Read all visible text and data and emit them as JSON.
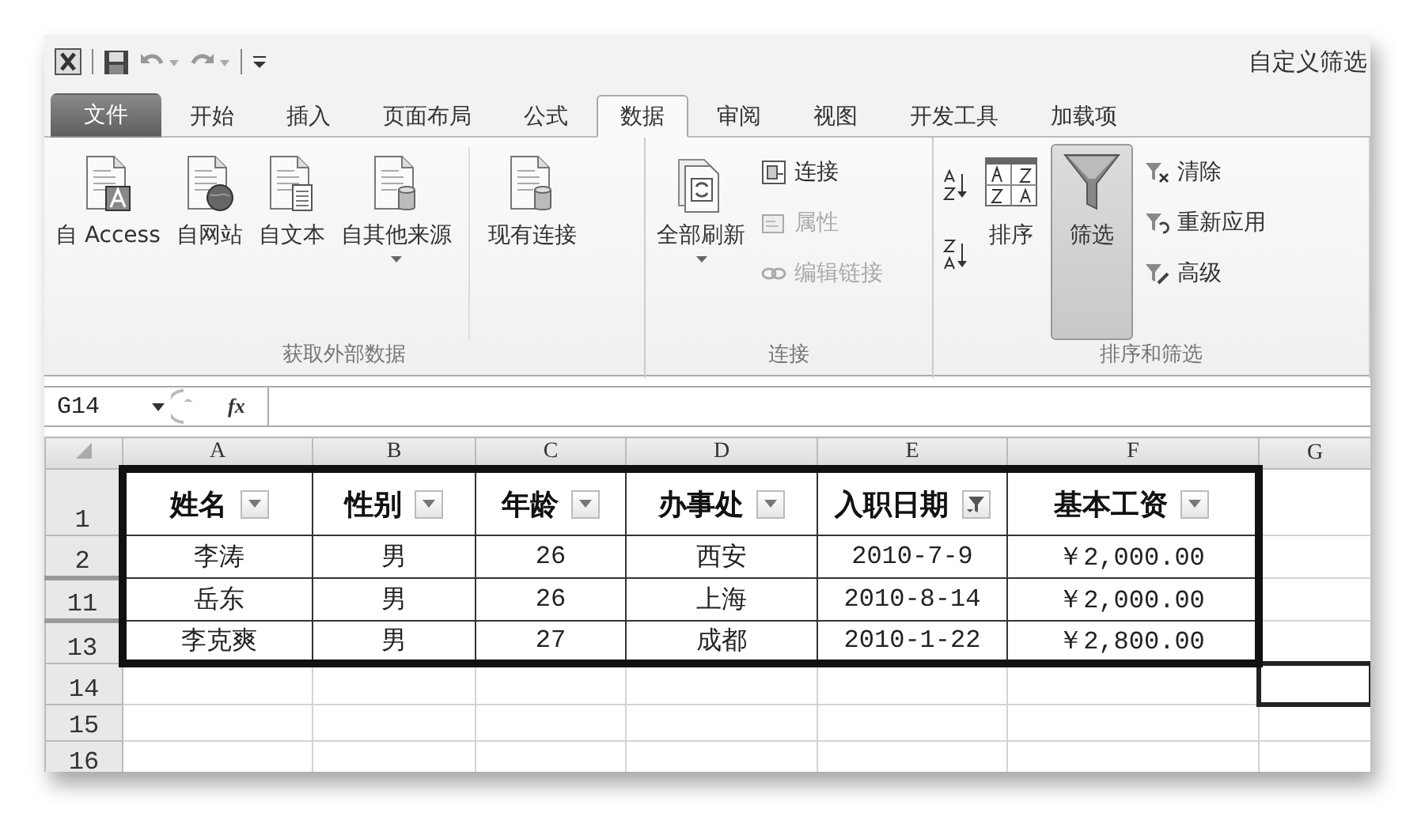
{
  "window": {
    "title": "自定义筛选"
  },
  "tabs": [
    {
      "label": "文件",
      "kind": "file",
      "selected": false
    },
    {
      "label": "开始",
      "kind": "tab",
      "selected": false
    },
    {
      "label": "插入",
      "kind": "tab",
      "selected": false
    },
    {
      "label": "页面布局",
      "kind": "tab",
      "selected": false
    },
    {
      "label": "公式",
      "kind": "tab",
      "selected": false
    },
    {
      "label": "数据",
      "kind": "tab",
      "selected": true
    },
    {
      "label": "审阅",
      "kind": "tab",
      "selected": false
    },
    {
      "label": "视图",
      "kind": "tab",
      "selected": false
    },
    {
      "label": "开发工具",
      "kind": "tab",
      "selected": false
    },
    {
      "label": "加载项",
      "kind": "tab",
      "selected": false
    }
  ],
  "ribbon": {
    "groups": [
      {
        "label": "获取外部数据",
        "items": [
          {
            "kind": "large",
            "label": "自 Access",
            "dropdown": false
          },
          {
            "kind": "large",
            "label": "自网站",
            "dropdown": false
          },
          {
            "kind": "large",
            "label": "自文本",
            "dropdown": false
          },
          {
            "kind": "large",
            "label": "自其他来源",
            "dropdown": true
          },
          {
            "kind": "separator"
          },
          {
            "kind": "large",
            "label": "现有连接",
            "dropdown": false
          }
        ]
      },
      {
        "label": "连接",
        "items": [
          {
            "kind": "large",
            "label": "全部刷新",
            "dropdown": true
          },
          {
            "kind": "small",
            "label": "连接",
            "disabled": false
          },
          {
            "kind": "small",
            "label": "属性",
            "disabled": true
          },
          {
            "kind": "small",
            "label": "编辑链接",
            "disabled": true
          }
        ]
      },
      {
        "label": "排序和筛选",
        "items": [
          {
            "kind": "sort-ascending"
          },
          {
            "kind": "sort-descending"
          },
          {
            "kind": "large",
            "label": "排序",
            "dropdown": false
          },
          {
            "kind": "large",
            "label": "筛选",
            "dropdown": false,
            "selected": true
          },
          {
            "kind": "small",
            "label": "清除",
            "disabled": false
          },
          {
            "kind": "small",
            "label": "重新应用",
            "disabled": false
          },
          {
            "kind": "small",
            "label": "高级",
            "disabled": false
          }
        ]
      }
    ]
  },
  "formula_bar": {
    "name_box": "G14",
    "function_label": "fx"
  },
  "table": {
    "columns": [
      "A",
      "B",
      "C",
      "D",
      "E",
      "F",
      "G"
    ],
    "header_row": "1",
    "header": [
      {
        "text": "姓名",
        "filtered": false
      },
      {
        "text": "性别",
        "filtered": false
      },
      {
        "text": "年龄",
        "filtered": false
      },
      {
        "text": "办事处",
        "filtered": false
      },
      {
        "text": "入职日期",
        "filtered": true
      },
      {
        "text": "基本工资",
        "filtered": false
      }
    ],
    "rows": [
      {
        "number": "2",
        "after_hidden": false,
        "cells": [
          "李涛",
          "男",
          "26",
          "西安",
          "2010-7-9",
          "￥2,000.00"
        ]
      },
      {
        "number": "11",
        "after_hidden": true,
        "cells": [
          "岳东",
          "男",
          "26",
          "上海",
          "2010-8-14",
          "￥2,000.00"
        ]
      },
      {
        "number": "13",
        "after_hidden": true,
        "cells": [
          "李克爽",
          "男",
          "27",
          "成都",
          "2010-1-22",
          "￥2,800.00"
        ]
      }
    ],
    "empty_rows": [
      {
        "number": "14",
        "selected_cells": [
          false,
          false,
          false,
          false,
          false,
          false,
          true
        ]
      },
      {
        "number": "15"
      },
      {
        "number": "16"
      }
    ]
  }
}
